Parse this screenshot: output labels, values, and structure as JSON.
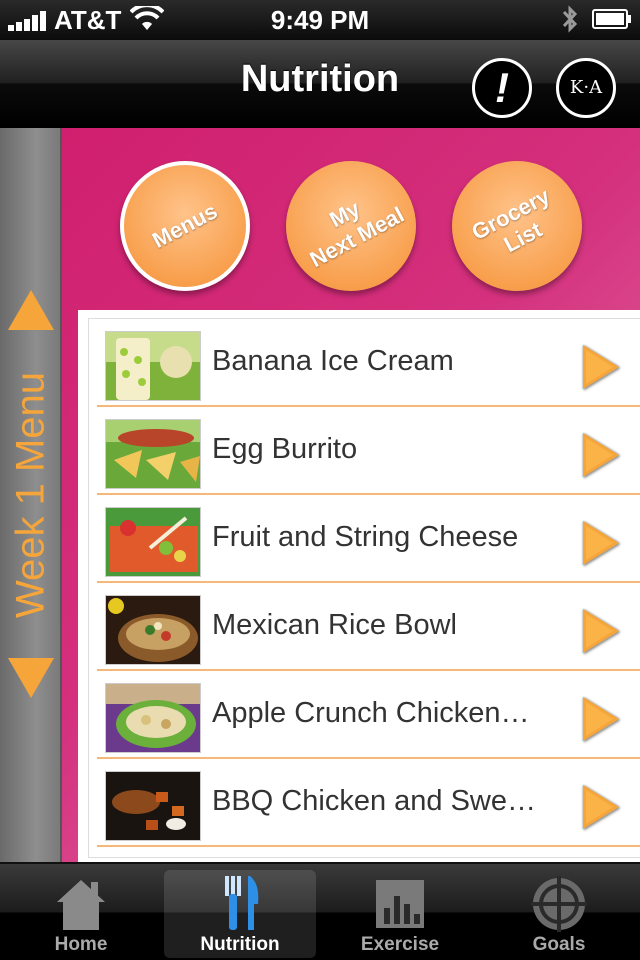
{
  "status_bar": {
    "carrier": "AT&T",
    "time": "9:49 PM"
  },
  "nav": {
    "title": "Nutrition",
    "info_label": "!",
    "logo_text": "K·A"
  },
  "sidebar": {
    "label": "Week 1 Menu"
  },
  "circle_buttons": [
    {
      "label": "Menus",
      "active": true
    },
    {
      "label": "My\nNext Meal",
      "active": false
    },
    {
      "label": "Grocery\nList",
      "active": false
    }
  ],
  "menu_items": [
    {
      "label": "Banana Ice Cream",
      "thumb": "banana-ice-cream-photo"
    },
    {
      "label": "Egg Burrito",
      "thumb": "egg-burrito-photo"
    },
    {
      "label": "Fruit and String Cheese",
      "thumb": "fruit-string-cheese-photo"
    },
    {
      "label": "Mexican Rice Bowl",
      "thumb": "mexican-rice-bowl-photo"
    },
    {
      "label": "Apple Crunch Chicken…",
      "thumb": "apple-crunch-chicken-photo"
    },
    {
      "label": "BBQ Chicken and Swe…",
      "thumb": "bbq-chicken-photo"
    }
  ],
  "tabs": [
    {
      "label": "Home",
      "icon": "home-icon",
      "active": false
    },
    {
      "label": "Nutrition",
      "icon": "fork-knife-icon",
      "active": true
    },
    {
      "label": "Exercise",
      "icon": "bar-chart-icon",
      "active": false
    },
    {
      "label": "Goals",
      "icon": "target-icon",
      "active": false
    }
  ],
  "colors": {
    "accent_orange": "#f5a53a",
    "pink": "#d01f6e",
    "divider": "#f5b878"
  }
}
